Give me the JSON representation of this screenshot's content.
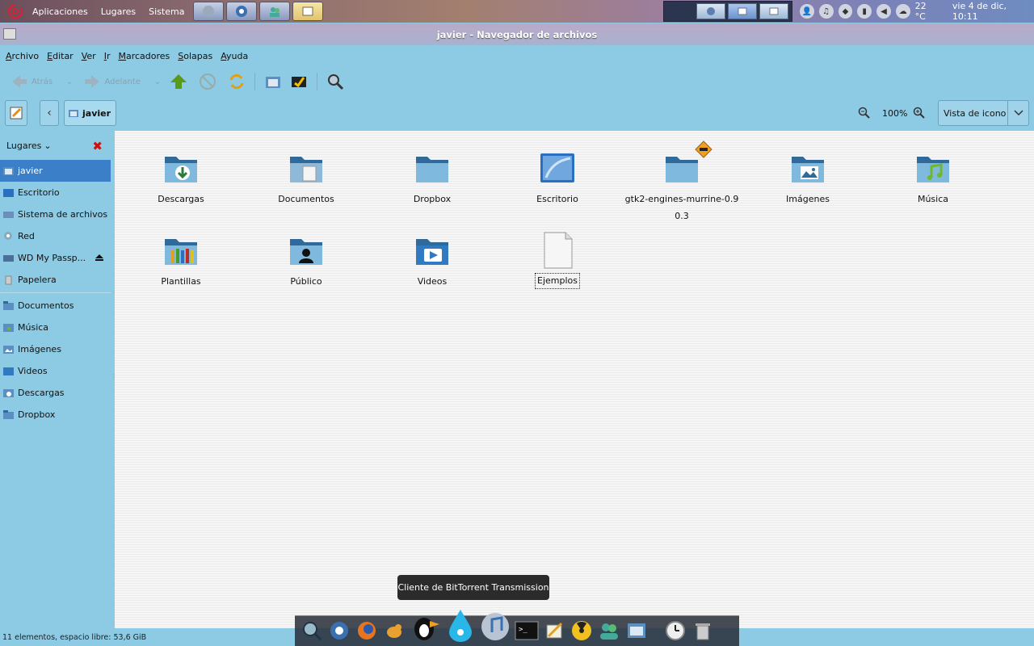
{
  "top_panel": {
    "menu": [
      "Aplicaciones",
      "Lugares",
      "Sistema"
    ],
    "weather": "22 °C",
    "clock": "vie  4 de dic, 10:11"
  },
  "window": {
    "title": "javier - Navegador de archivos"
  },
  "menubar": {
    "items": [
      {
        "u": "A",
        "rest": "rchivo"
      },
      {
        "u": "E",
        "rest": "ditar"
      },
      {
        "u": "V",
        "rest": "er"
      },
      {
        "u": "I",
        "rest": "r"
      },
      {
        "u": "M",
        "rest": "arcadores"
      },
      {
        "u": "S",
        "rest": "olapas"
      },
      {
        "u": "A",
        "rest": "yuda"
      }
    ]
  },
  "toolbar": {
    "back_label": "Atrás",
    "forward_label": "Adelante"
  },
  "location": {
    "crumb": "javier",
    "zoom": "100%",
    "view_mode": "Vista de icono"
  },
  "sidebar": {
    "header": "Lugares",
    "places": [
      {
        "label": "javier",
        "icon": "home-icon"
      },
      {
        "label": "Escritorio",
        "icon": "desktop-icon"
      },
      {
        "label": "Sistema de archivos",
        "icon": "drive-icon"
      },
      {
        "label": "Red",
        "icon": "network-icon"
      },
      {
        "label": "WD My Passp...",
        "icon": "external-drive-icon"
      },
      {
        "label": "Papelera",
        "icon": "trash-icon"
      }
    ],
    "bookmarks": [
      {
        "label": "Documentos",
        "icon": "folder-icon"
      },
      {
        "label": "Música",
        "icon": "music-folder-icon"
      },
      {
        "label": "Imágenes",
        "icon": "pictures-folder-icon"
      },
      {
        "label": "Videos",
        "icon": "videos-folder-icon"
      },
      {
        "label": "Descargas",
        "icon": "downloads-folder-icon"
      },
      {
        "label": "Dropbox",
        "icon": "folder-icon"
      }
    ]
  },
  "files": [
    {
      "name": "Descargas",
      "icon": "downloads-folder-icon"
    },
    {
      "name": "Documentos",
      "icon": "documents-folder-icon"
    },
    {
      "name": "Dropbox",
      "icon": "folder-icon"
    },
    {
      "name": "Escritorio",
      "icon": "desktop-folder-icon"
    },
    {
      "name": "gtk2-engines-murrine-0.90.3",
      "icon": "folder-icon"
    },
    {
      "name": "Imágenes",
      "icon": "pictures-folder-icon"
    },
    {
      "name": "Música",
      "icon": "music-folder-icon"
    },
    {
      "name": "Plantillas",
      "icon": "templates-folder-icon"
    },
    {
      "name": "Público",
      "icon": "public-folder-icon"
    },
    {
      "name": "Videos",
      "icon": "videos-folder-icon"
    },
    {
      "name": "Ejemplos",
      "icon": "file-icon"
    }
  ],
  "status": "11 elementos, espacio libre: 53,6 GiB",
  "dock": {
    "tooltip": "Cliente de BitTorrent Transmission"
  },
  "colors": {
    "background": "#8dcbe4",
    "selection": "#3a7fc8",
    "folder": "#3f7fb3"
  }
}
